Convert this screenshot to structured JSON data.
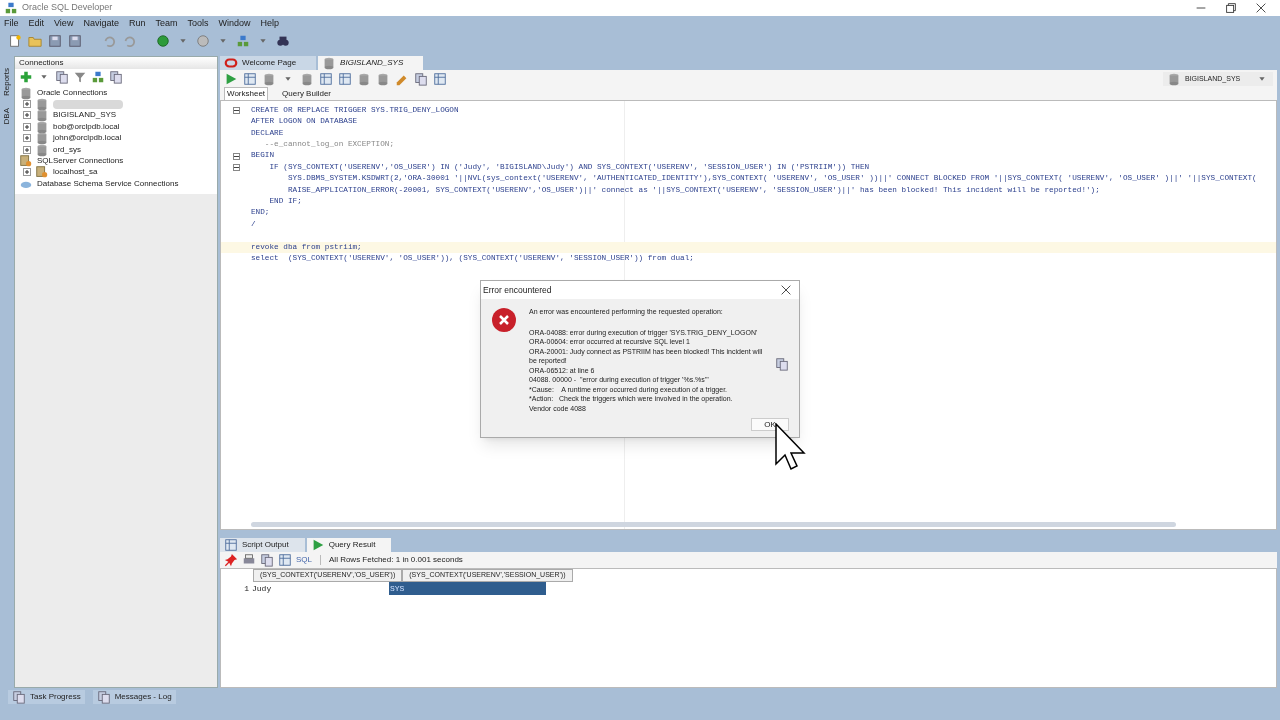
{
  "window": {
    "title": "Oracle SQL Developer"
  },
  "menu": [
    "File",
    "Edit",
    "View",
    "Navigate",
    "Run",
    "Team",
    "Tools",
    "Window",
    "Help"
  ],
  "side_tabs": [
    "Reports",
    "DBA"
  ],
  "connections_panel": {
    "title": "Connections",
    "tree": [
      {
        "label": "Oracle Connections",
        "kind": "oracle-folder",
        "expanded": true,
        "children": [
          {
            "kind": "redacted",
            "expanded": false
          },
          {
            "label": "BIGISLAND_SYS",
            "kind": "open-connection",
            "expanded": false
          },
          {
            "label": "bob@orclpdb.local",
            "kind": "connection",
            "expanded": false
          },
          {
            "label": "john@orclpdb.local",
            "kind": "connection",
            "expanded": false
          },
          {
            "label": "ord_sys",
            "kind": "connection",
            "expanded": false
          }
        ]
      },
      {
        "label": "SQLServer Connections",
        "kind": "sqlserver-folder",
        "expanded": true,
        "children": [
          {
            "label": "localhost_sa",
            "kind": "sqlserver-connection",
            "expanded": false
          }
        ]
      },
      {
        "label": "Database Schema Service Connections",
        "kind": "cloud-folder"
      }
    ]
  },
  "editor_tabs": [
    {
      "label": "Welcome Page",
      "selected": false
    },
    {
      "label": "BIGISLAND_SYS",
      "selected": true
    }
  ],
  "connection_selector": "BIGISLAND_SYS",
  "sub_tabs": [
    {
      "label": "Worksheet",
      "selected": true
    },
    {
      "label": "Query Builder",
      "selected": false
    }
  ],
  "code_lines": [
    {
      "text": "CREATE OR REPLACE TRIGGER SYS.TRIG_DENY_LOGON",
      "kind": "code",
      "fold": true,
      "highlighted": false
    },
    {
      "text": "AFTER LOGON ON DATABASE",
      "kind": "code",
      "fold": false,
      "highlighted": false
    },
    {
      "text": "DECLARE",
      "kind": "code",
      "fold": false,
      "highlighted": false
    },
    {
      "text": "   --e_cannot_log_on EXCEPTION;",
      "kind": "comment",
      "fold": false,
      "highlighted": false
    },
    {
      "text": "BEGIN",
      "kind": "code",
      "fold": true,
      "highlighted": false
    },
    {
      "text": "    IF (SYS_CONTEXT('USERENV','OS_USER') IN ('Judy', 'BIGISLAND\\Judy') AND SYS_CONTEXT('USERENV', 'SESSION_USER') IN ('PSTRIIM')) THEN",
      "kind": "code",
      "fold": true,
      "highlighted": false
    },
    {
      "text": "        SYS.DBMS_SYSTEM.KSDWRT(2,'ORA-30001 '||NVL(sys_context('USERENV', 'AUTHENTICATED_IDENTITY'),SYS_CONTEXT( 'USERENV', 'OS_USER' ))||' CONNECT BLOCKED FROM '||SYS_CONTEXT( 'USERENV', 'OS_USER' )||' '||SYS_CONTEXT(",
      "kind": "code",
      "fold": false,
      "highlighted": false
    },
    {
      "text": "        RAISE_APPLICATION_ERROR(-20001, SYS_CONTEXT('USERENV','OS_USER')||' connect as '||SYS_CONTEXT('USERENV', 'SESSION_USER')||' has been blocked! This incident will be reported!');",
      "kind": "code",
      "fold": false,
      "highlighted": false
    },
    {
      "text": "    END IF;",
      "kind": "code",
      "fold": false,
      "highlighted": false
    },
    {
      "text": "END;",
      "kind": "code",
      "fold": false,
      "highlighted": false
    },
    {
      "text": "/",
      "kind": "code",
      "fold": false,
      "highlighted": false
    },
    {
      "kind": "blank",
      "fold": false,
      "highlighted": false
    },
    {
      "text": "revoke dba from pstriim;",
      "kind": "code",
      "fold": false,
      "highlighted": true
    },
    {
      "text": "select  (SYS_CONTEXT('USERENV', 'OS_USER')), (SYS_CONTEXT('USERENV', 'SESSION_USER')) from dual;",
      "kind": "code",
      "fold": false,
      "highlighted": false
    }
  ],
  "output_tabs": [
    {
      "label": "Script Output",
      "selected": false
    },
    {
      "label": "Query Result",
      "selected": true
    }
  ],
  "output_toolbar": {
    "sql_label": "SQL",
    "status": "All Rows Fetched: 1 in 0.001 seconds"
  },
  "result_table": {
    "columns": [
      "(SYS_CONTEXT('USERENV','OS_USER'))",
      "(SYS_CONTEXT('USERENV','SESSION_USER'))"
    ],
    "rows": [
      {
        "number": "1",
        "cells": [
          {
            "text": "Judy",
            "selected": false
          },
          {
            "text": "SYS",
            "selected": true
          }
        ]
      }
    ]
  },
  "bottom_tabs": [
    "Task Progress",
    "Messages - Log"
  ],
  "dialog": {
    "title": "Error encountered",
    "intro": "An error was encountered performing the requested operation:",
    "lines": [
      "ORA-04088: error during execution of trigger 'SYS.TRIG_DENY_LOGON'",
      "ORA-00604: error occurred at recursive SQL level 1",
      "ORA-20001: Judy connect as PSTRIIM has been blocked! This incident will be reported!",
      "ORA-06512: at line 6",
      "04088. 00000 -  \"error during execution of trigger '%s.%s'\"",
      "*Cause:    A runtime error occurred during execution of a trigger.",
      "*Action:   Check the triggers which were involved in the operation.",
      "Vendor code 4088"
    ],
    "button": "OK"
  }
}
